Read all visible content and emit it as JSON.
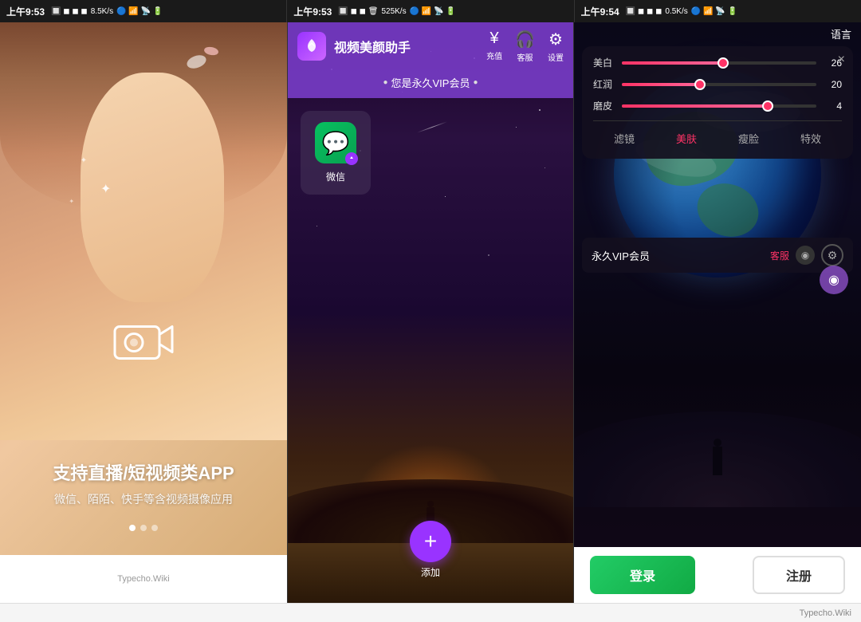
{
  "meta": {
    "time1": "上午9:53",
    "time2": "上午9:53",
    "time3": "上午9:54",
    "speed1": "8.5K/s",
    "speed2": "525K/s",
    "speed3": "0.5K/s"
  },
  "panel1": {
    "title": "支持直播/短视频类APP",
    "subtitle": "微信、陌陌、快手等含视频摄像应用",
    "dots": [
      true,
      false,
      false
    ],
    "credit": "Typecho.Wiki"
  },
  "panel2": {
    "app_name": "视频美颜助手",
    "actions": {
      "recharge_icon": "¥",
      "recharge_label": "充值",
      "service_icon": "🎧",
      "service_label": "客服",
      "settings_icon": "⚙",
      "settings_label": "设置"
    },
    "vip_notice": "您是永久VIP会员",
    "wechat_label": "微信",
    "add_label": "添加"
  },
  "panel3": {
    "lang_btn": "语言",
    "close_icon": "×",
    "sliders": [
      {
        "label": "美白",
        "value": 26,
        "percent": 52
      },
      {
        "label": "红润",
        "value": 20,
        "percent": 40
      },
      {
        "label": "磨皮",
        "value": 4,
        "percent": 75
      }
    ],
    "tabs": [
      {
        "label": "滤镜",
        "active": false
      },
      {
        "label": "美肤",
        "active": true
      },
      {
        "label": "瘦脸",
        "active": false
      },
      {
        "label": "特效",
        "active": false
      }
    ],
    "vip_text": "永久VIP会员",
    "service_label": "客服",
    "login_label": "登录",
    "register_label": "注册"
  },
  "credit": "Typecho.Wiki"
}
